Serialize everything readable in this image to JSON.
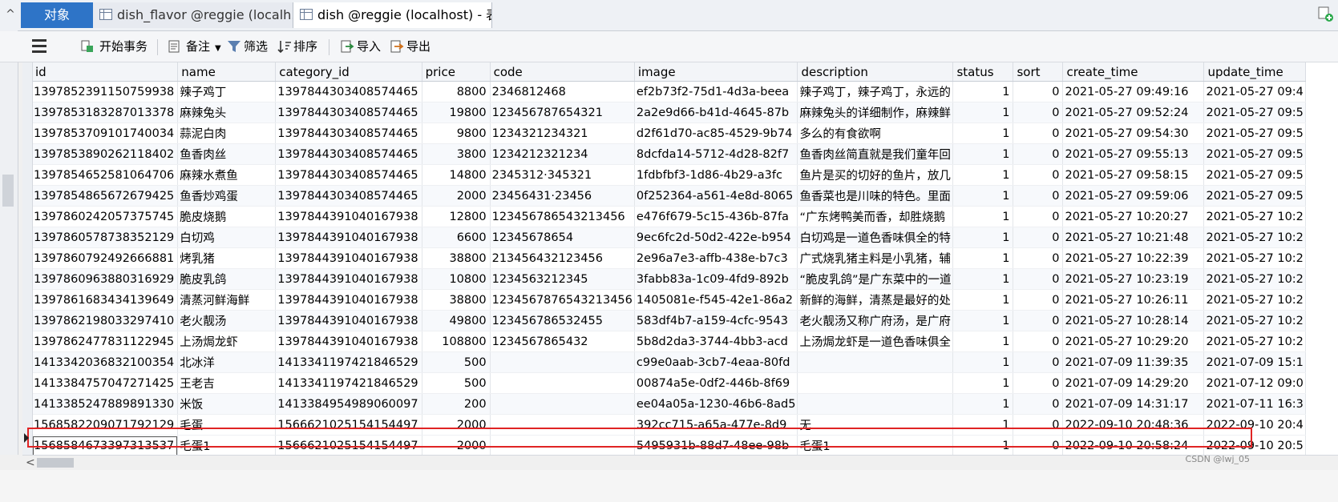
{
  "tabs": {
    "objects_label": "对象",
    "tab1_label": "dish_flavor @reggie (localh...",
    "tab2_label": "dish @reggie (localhost) - 表"
  },
  "toolbar": {
    "begin_transaction": "开始事务",
    "memo": "备注",
    "filter": "筛选",
    "sort": "排序",
    "import": "导入",
    "export": "导出"
  },
  "grid": {
    "columns": [
      "id",
      "name",
      "category_id",
      "price",
      "code",
      "image",
      "description",
      "status",
      "sort",
      "create_time",
      "update_time"
    ],
    "rows": [
      [
        "1397852391150759938",
        "辣子鸡丁",
        "1397844303408574465",
        "8800",
        "2346812468",
        "ef2b73f2-75d1-4d3a-beea",
        "辣子鸡丁，辣子鸡丁，永远的",
        "1",
        "0",
        "2021-05-27 09:49:16",
        "2021-05-27 09:4"
      ],
      [
        "1397853183287013378",
        "麻辣兔头",
        "1397844303408574465",
        "19800",
        "123456787654321",
        "2a2e9d66-b41d-4645-87b",
        "麻辣兔头的详细制作，麻辣鲜",
        "1",
        "0",
        "2021-05-27 09:52:24",
        "2021-05-27 09:5"
      ],
      [
        "1397853709101740034",
        "蒜泥白肉",
        "1397844303408574465",
        "9800",
        "1234321234321",
        "d2f61d70-ac85-4529-9b74",
        "多么的有食欲啊",
        "1",
        "0",
        "2021-05-27 09:54:30",
        "2021-05-27 09:5"
      ],
      [
        "1397853890262118402",
        "鱼香肉丝",
        "1397844303408574465",
        "3800",
        "1234212321234",
        "8dcfda14-5712-4d28-82f7",
        "鱼香肉丝简直就是我们童年回",
        "1",
        "0",
        "2021-05-27 09:55:13",
        "2021-05-27 09:5"
      ],
      [
        "1397854652581064706",
        "麻辣水煮鱼",
        "1397844303408574465",
        "14800",
        "2345312·345321",
        "1fdbfbf3-1d86-4b29-a3fc",
        "鱼片是买的切好的鱼片，放几",
        "1",
        "0",
        "2021-05-27 09:58:15",
        "2021-05-27 09:5"
      ],
      [
        "1397854865672679425",
        "鱼香炒鸡蛋",
        "1397844303408574465",
        "2000",
        "23456431·23456",
        "0f252364-a561-4e8d-8065",
        "鱼香菜也是川味的特色。里面",
        "1",
        "0",
        "2021-05-27 09:59:06",
        "2021-05-27 09:5"
      ],
      [
        "1397860242057375745",
        "脆皮烧鹅",
        "1397844391040167938",
        "12800",
        "123456786543213456",
        "e476f679-5c15-436b-87fa",
        "“广东烤鸭美而香，却胜烧鹅",
        "1",
        "0",
        "2021-05-27 10:20:27",
        "2021-05-27 10:2"
      ],
      [
        "1397860578738352129",
        "白切鸡",
        "1397844391040167938",
        "6600",
        "12345678654",
        "9ec6fc2d-50d2-422e-b954",
        "白切鸡是一道色香味俱全的特",
        "1",
        "0",
        "2021-05-27 10:21:48",
        "2021-05-27 10:2"
      ],
      [
        "1397860792492666881",
        "烤乳猪",
        "1397844391040167938",
        "38800",
        "213456432123456",
        "2e96a7e3-affb-438e-b7c3",
        "广式烧乳猪主料是小乳猪，辅",
        "1",
        "0",
        "2021-05-27 10:22:39",
        "2021-05-27 10:2"
      ],
      [
        "1397860963880316929",
        "脆皮乳鸽",
        "1397844391040167938",
        "10800",
        "1234563212345",
        "3fabb83a-1c09-4fd9-892b",
        "“脆皮乳鸽”是广东菜中的一道",
        "1",
        "0",
        "2021-05-27 10:23:19",
        "2021-05-27 10:2"
      ],
      [
        "1397861683434139649",
        "清蒸河鲜海鲜",
        "1397844391040167938",
        "38800",
        "1234567876543213456",
        "1405081e-f545-42e1-86a2",
        "新鲜的海鲜，清蒸是最好的处",
        "1",
        "0",
        "2021-05-27 10:26:11",
        "2021-05-27 10:2"
      ],
      [
        "1397862198033297410",
        "老火靓汤",
        "1397844391040167938",
        "49800",
        "123456786532455",
        "583df4b7-a159-4cfc-9543",
        "老火靓汤又称广府汤，是广府",
        "1",
        "0",
        "2021-05-27 10:28:14",
        "2021-05-27 10:2"
      ],
      [
        "1397862477831122945",
        "上汤焗龙虾",
        "1397844391040167938",
        "108800",
        "1234567865432",
        "5b8d2da3-3744-4bb3-acd",
        "上汤焗龙虾是一道色香味俱全",
        "1",
        "0",
        "2021-05-27 10:29:20",
        "2021-05-27 10:2"
      ],
      [
        "1413342036832100354",
        "北冰洋",
        "1413341197421846529",
        "500",
        "",
        "c99e0aab-3cb7-4eaa-80fd",
        "",
        "1",
        "0",
        "2021-07-09 11:39:35",
        "2021-07-09 15:1"
      ],
      [
        "1413384757047271425",
        "王老吉",
        "1413341197421846529",
        "500",
        "",
        "00874a5e-0df2-446b-8f69",
        "",
        "1",
        "0",
        "2021-07-09 14:29:20",
        "2021-07-12 09:0"
      ],
      [
        "1413385247889891330",
        "米饭",
        "1413384954989060097",
        "200",
        "",
        "ee04a05a-1230-46b6-8ad5",
        "",
        "1",
        "0",
        "2021-07-09 14:31:17",
        "2021-07-11 16:3"
      ],
      [
        "1568582209071792129",
        "毛蛋",
        "1566621025154154497",
        "2000",
        "",
        "392cc715-a65a-477e-8d9",
        "无",
        "1",
        "0",
        "2022-09-10 20:48:36",
        "2022-09-10 20:4"
      ],
      [
        "1568584673397313537",
        "毛蛋1",
        "1566621025154154497",
        "2000",
        "",
        "5495931b-88d7-48ee-98b",
        "毛蛋1",
        "1",
        "0",
        "2022-09-10 20:58:24",
        "2022-09-10 20:5"
      ]
    ]
  },
  "watermark": "CSDN @lwj_05"
}
